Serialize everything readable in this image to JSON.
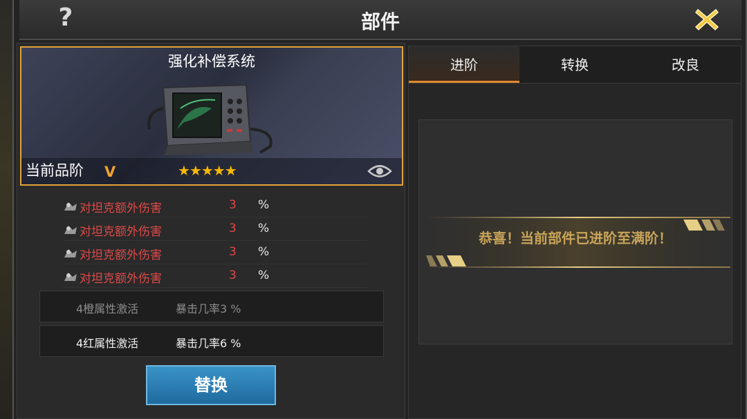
{
  "window": {
    "title": "部件",
    "help_label": "?"
  },
  "item": {
    "name": "强化补偿系统",
    "grade_label": "当前品阶",
    "grade_value": "V",
    "stars": "★★★★★",
    "star_count": 5,
    "frame_color": "#e3a43a"
  },
  "attributes": [
    {
      "name": "对坦克额外伤害",
      "value": "3",
      "unit": "%"
    },
    {
      "name": "对坦克额外伤害",
      "value": "3",
      "unit": "%"
    },
    {
      "name": "对坦克额外伤害",
      "value": "3",
      "unit": "%"
    },
    {
      "name": "对坦克额外伤害",
      "value": "3",
      "unit": "%"
    }
  ],
  "set_bonuses": [
    {
      "name": "4橙属性激活",
      "effect": "暴击几率3 %",
      "active": false
    },
    {
      "name": "4红属性激活",
      "effect": "暴击几率6 %",
      "active": true
    }
  ],
  "replace_button": "替换",
  "tabs": [
    {
      "label": "进阶",
      "active": true
    },
    {
      "label": "转换",
      "active": false
    },
    {
      "label": "改良",
      "active": false
    }
  ],
  "message": "恭喜！当前部件已进阶至满阶！",
  "colors": {
    "accent": "#e0892b",
    "attribute_red": "#e04848",
    "button_blue": "#2a7fb4",
    "banner_gold": "#c8a45a"
  }
}
